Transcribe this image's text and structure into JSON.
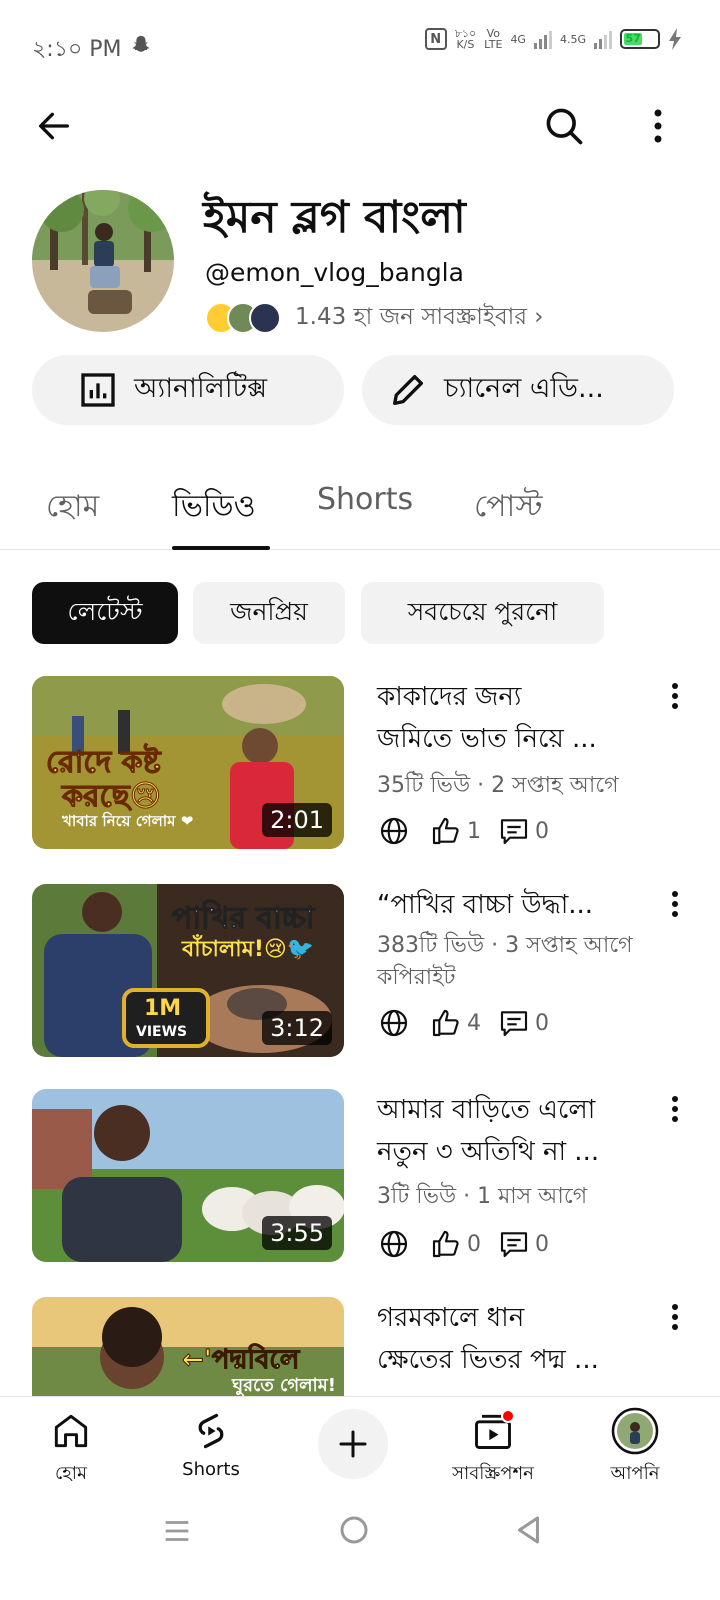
{
  "status_bar": {
    "time": "২:১০ PM",
    "net_speed_value": "৮১০",
    "net_speed_unit": "K/S",
    "volte_top": "Vo",
    "volte_bottom": "LTE",
    "net_1": "4G",
    "net_2": "4.5G",
    "battery": "57"
  },
  "header": {
    "back_icon": "arrow-left-icon",
    "search_icon": "search-icon",
    "more_icon": "more-vert-icon"
  },
  "channel": {
    "name": "ইমন ব্লগ বাংলা",
    "handle": "@emon_vlog_bangla",
    "subscribers": "1.43 হা জন সাবস্ক্রাইবার ›"
  },
  "actions": {
    "analytics_label": "অ্যানালিটিক্স",
    "edit_label": "চ্যানেল এডি..."
  },
  "tabs": [
    {
      "label": "হোম"
    },
    {
      "label": "ভিডিও"
    },
    {
      "label": "Shorts"
    },
    {
      "label": "পোস্ট"
    }
  ],
  "chips": [
    {
      "label": "লেটেস্ট"
    },
    {
      "label": "জনপ্রিয়"
    },
    {
      "label": "সবচেয়ে পুরনো"
    }
  ],
  "videos": [
    {
      "title_1": "কাকাদের জন্য",
      "title_2": "জমিতে ভাত নিয়ে ...",
      "meta": "35টি ভিউ · 2 সপ্তাহ আগে",
      "meta_2": "",
      "duration": "2:01",
      "likes": "1",
      "comments": "0",
      "overlay_1": "রোদে কষ্ট",
      "overlay_2": "করছে😢",
      "overlay_3": "খাবার নিয়ে গেলাম ❤"
    },
    {
      "title_1": "“পাখির বাচ্চা উদ্ধা...",
      "title_2": "",
      "meta": "383টি ভিউ · 3 সপ্তাহ আগে",
      "meta_2": "কপিরাইট",
      "duration": "3:12",
      "likes": "4",
      "comments": "0",
      "overlay_1": "পাখির বাচ্চা",
      "overlay_2": "বাঁচালাম!😢🐦",
      "overlay_3": "1M",
      "overlay_4": "VIEWS"
    },
    {
      "title_1": "আমার বাড়িতে এলো",
      "title_2": "নতুন ৩ অতিথি না ...",
      "meta": "3টি ভিউ · 1 মাস আগে",
      "meta_2": "",
      "duration": "3:55",
      "likes": "0",
      "comments": "0"
    },
    {
      "title_1": "গরমকালে ধান",
      "title_2": "ক্ষেতের ভিতর পদ্ম ...",
      "overlay_1": "←'পদ্মবিলে",
      "overlay_2": "ঘুরতে গেলাম!"
    }
  ],
  "bottom_nav": {
    "home": "হোম",
    "shorts": "Shorts",
    "subscriptions": "সাবস্ক্রিপশন",
    "you": "আপনি"
  },
  "colors": {
    "accent_red": "#ff0000",
    "chip_active": "#0f0f0f",
    "chip_bg": "#f2f2f2",
    "meta_gray": "#606060"
  }
}
